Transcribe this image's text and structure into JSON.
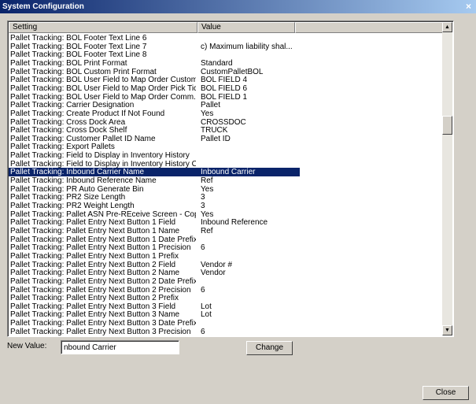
{
  "window": {
    "title": "System Configuration",
    "close_glyph": "×"
  },
  "columns": {
    "setting": "Setting",
    "value": "Value"
  },
  "rows": [
    {
      "setting": "Pallet Tracking: BOL Footer Text Line 6",
      "value": ""
    },
    {
      "setting": "Pallet Tracking: BOL Footer Text Line 7",
      "value": "c) Maximum liability shal..."
    },
    {
      "setting": "Pallet Tracking: BOL Footer Text Line 8",
      "value": ""
    },
    {
      "setting": "Pallet Tracking: BOL Print Format",
      "value": "Standard"
    },
    {
      "setting": "Pallet Tracking: BOL Custom Print Format",
      "value": "CustomPalletBOL"
    },
    {
      "setting": "Pallet Tracking: BOL User Field to Map Order Custom...",
      "value": "BOL FIELD 4"
    },
    {
      "setting": "Pallet Tracking: BOL User Field to Map Order Pick Tic...",
      "value": "BOL FIELD 6"
    },
    {
      "setting": "Pallet Tracking: BOL User Field to Map Order Comm...",
      "value": "BOL FIELD 1"
    },
    {
      "setting": "Pallet Tracking: Carrier Designation",
      "value": "Pallet"
    },
    {
      "setting": "Pallet Tracking: Create Product If Not Found",
      "value": "Yes"
    },
    {
      "setting": "Pallet Tracking: Cross Dock Area",
      "value": "CROSSDOC"
    },
    {
      "setting": "Pallet Tracking: Cross Dock Shelf",
      "value": "TRUCK"
    },
    {
      "setting": "Pallet Tracking: Customer Pallet ID Name",
      "value": "Pallet ID"
    },
    {
      "setting": "Pallet Tracking: Export Pallets",
      "value": ""
    },
    {
      "setting": "Pallet Tracking: Field to Display in Inventory History",
      "value": ""
    },
    {
      "setting": "Pallet Tracking: Field to Display in Inventory History C...",
      "value": ""
    },
    {
      "setting": "Pallet Tracking: Inbound Carrier Name",
      "value": "Inbound Carrier"
    },
    {
      "setting": "Pallet Tracking: Inbound Reference Name",
      "value": "Ref"
    },
    {
      "setting": "Pallet Tracking: PR Auto Generate Bin",
      "value": "Yes"
    },
    {
      "setting": "Pallet Tracking: PR2 Size Length",
      "value": "3"
    },
    {
      "setting": "Pallet Tracking: PR2 Weight Length",
      "value": "3"
    },
    {
      "setting": "Pallet Tracking: Pallet ASN Pre-REceive Screen - Cop...",
      "value": "Yes"
    },
    {
      "setting": "Pallet Tracking: Pallet Entry Next Button 1 Field",
      "value": "Inbound Reference"
    },
    {
      "setting": "Pallet Tracking: Pallet Entry Next Button 1 Name",
      "value": "Ref"
    },
    {
      "setting": "Pallet Tracking: Pallet Entry Next Button 1 Date Prefix",
      "value": ""
    },
    {
      "setting": "Pallet Tracking: Pallet Entry Next Button 1 Precision",
      "value": "6"
    },
    {
      "setting": "Pallet Tracking: Pallet Entry Next Button 1 Prefix",
      "value": ""
    },
    {
      "setting": "Pallet Tracking: Pallet Entry Next Button 2 Field",
      "value": "Vendor #"
    },
    {
      "setting": "Pallet Tracking: Pallet Entry Next Button 2 Name",
      "value": "Vendor"
    },
    {
      "setting": "Pallet Tracking: Pallet Entry Next Button 2 Date Prefix",
      "value": ""
    },
    {
      "setting": "Pallet Tracking: Pallet Entry Next Button 2 Precision",
      "value": "6"
    },
    {
      "setting": "Pallet Tracking: Pallet Entry Next Button 2 Prefix",
      "value": ""
    },
    {
      "setting": "Pallet Tracking: Pallet Entry Next Button 3 Field",
      "value": "Lot"
    },
    {
      "setting": "Pallet Tracking: Pallet Entry Next Button 3 Name",
      "value": "Lot"
    },
    {
      "setting": "Pallet Tracking: Pallet Entry Next Button 3 Date Prefix",
      "value": ""
    },
    {
      "setting": "Pallet Tracking: Pallet Entry Next Button 3 Precision",
      "value": "6"
    }
  ],
  "selected_row": 16,
  "scrollbar": {
    "up_glyph": "▲",
    "down_glyph": "▼"
  },
  "new_value": {
    "label": "New Value:",
    "value": "nbound Carrier"
  },
  "buttons": {
    "change": "Change",
    "close": "Close"
  },
  "colors": {
    "selection": "#0a246a",
    "title_start": "#0a246a",
    "title_end": "#a6caf0",
    "face": "#d4d0c8"
  }
}
